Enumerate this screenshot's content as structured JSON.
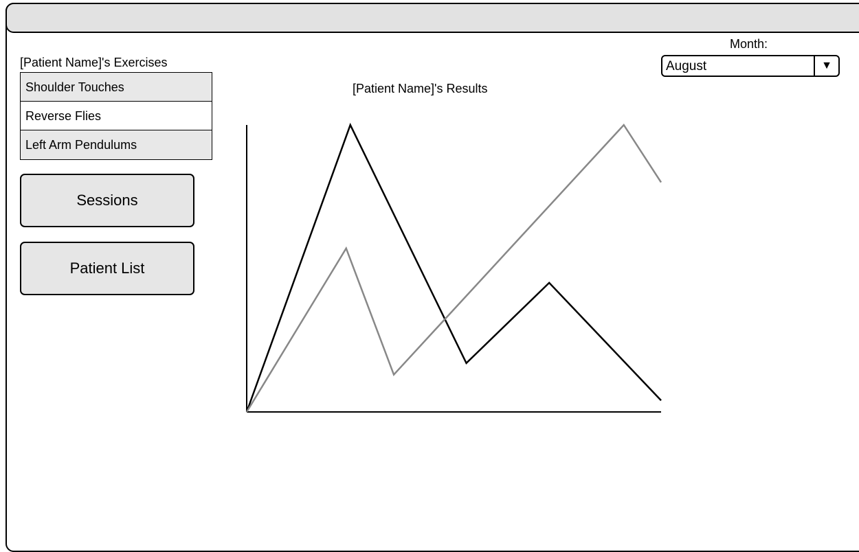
{
  "exercises": {
    "heading": "[Patient Name]'s Exercises",
    "items": [
      {
        "label": "Shoulder Touches",
        "shaded": true
      },
      {
        "label": "Reverse Flies",
        "shaded": false
      },
      {
        "label": "Left Arm Pendulums",
        "shaded": true
      }
    ]
  },
  "nav": {
    "sessions_label": "Sessions",
    "patient_list_label": "Patient List"
  },
  "month": {
    "label": "Month:",
    "selected": "August",
    "arrow_icon": "triangle-down-icon"
  },
  "chart": {
    "title": "[Patient Name]'s Results"
  },
  "chart_data": {
    "type": "line",
    "title": "[Patient Name]'s Results",
    "xlabel": "",
    "ylabel": "",
    "x": [
      0,
      1,
      2,
      3,
      4,
      5,
      6,
      7,
      8,
      9,
      10
    ],
    "xlim": [
      0,
      10
    ],
    "ylim": [
      0,
      100
    ],
    "grid": false,
    "series": [
      {
        "color": "#000000",
        "points": [
          [
            0,
            0
          ],
          [
            2.5,
            100
          ],
          [
            5.3,
            17
          ],
          [
            7.3,
            45
          ],
          [
            10,
            4
          ]
        ]
      },
      {
        "color": "#888888",
        "points": [
          [
            0,
            0
          ],
          [
            2.4,
            57
          ],
          [
            3.55,
            13
          ],
          [
            9.1,
            100
          ],
          [
            10,
            80
          ]
        ]
      }
    ]
  }
}
